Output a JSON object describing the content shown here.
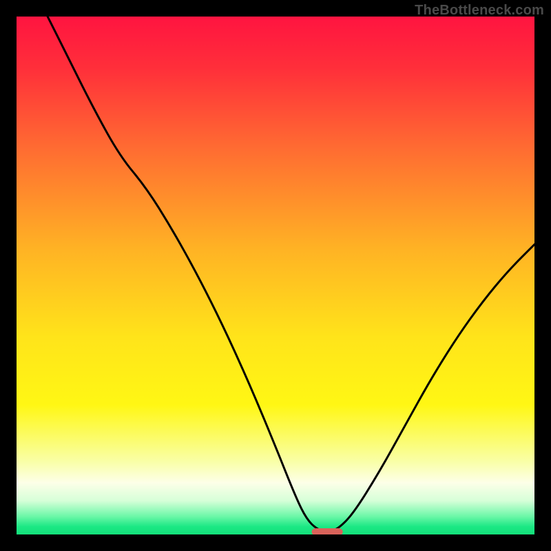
{
  "watermark": "TheBottleneck.com",
  "chart_data": {
    "type": "line",
    "title": "",
    "xlabel": "",
    "ylabel": "",
    "xlim": [
      0,
      100
    ],
    "ylim": [
      0,
      100
    ],
    "series": [
      {
        "name": "curve",
        "x": [
          6,
          10,
          15,
          20,
          25,
          30,
          35,
          40,
          45,
          50,
          54,
          56,
          58,
          60,
          62,
          65,
          70,
          75,
          80,
          85,
          90,
          95,
          100
        ],
        "y": [
          100,
          92,
          82,
          73,
          67,
          59,
          50,
          40,
          29,
          17,
          7,
          3,
          1,
          0.5,
          1,
          4,
          12,
          21,
          30,
          38,
          45,
          51,
          56
        ]
      }
    ],
    "marker": {
      "x": 60,
      "y": 0.5,
      "color": "#d9625a",
      "width": 6,
      "height": 1.4
    },
    "gradient_stops": [
      {
        "offset": 0.0,
        "color": "#ff1440"
      },
      {
        "offset": 0.1,
        "color": "#ff2f3a"
      },
      {
        "offset": 0.25,
        "color": "#ff6a32"
      },
      {
        "offset": 0.45,
        "color": "#ffb324"
      },
      {
        "offset": 0.62,
        "color": "#ffe41a"
      },
      {
        "offset": 0.75,
        "color": "#fff714"
      },
      {
        "offset": 0.86,
        "color": "#f9ffa8"
      },
      {
        "offset": 0.9,
        "color": "#fdffe8"
      },
      {
        "offset": 0.935,
        "color": "#d6ffd8"
      },
      {
        "offset": 0.965,
        "color": "#6cf7a8"
      },
      {
        "offset": 0.985,
        "color": "#1be884"
      },
      {
        "offset": 1.0,
        "color": "#13e07a"
      }
    ]
  }
}
